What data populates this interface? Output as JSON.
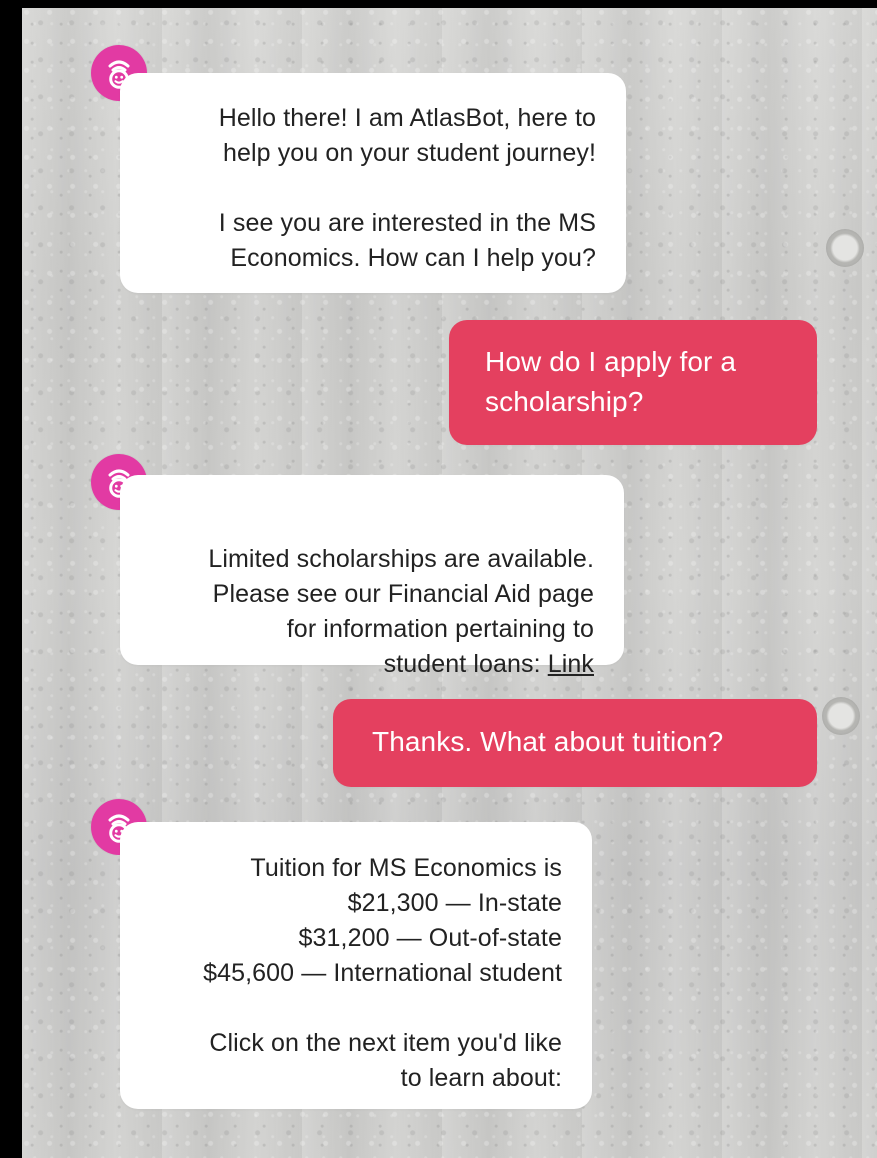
{
  "conversation": {
    "bot_name": "AtlasBot",
    "avatar_icon": "atlasbot-avatar-icon",
    "colors": {
      "bot_bubble": "#ffffff",
      "user_bubble": "#e4405f",
      "avatar": "#e23aa3"
    },
    "messages": [
      {
        "sender": "bot",
        "text": "Hello there! I am AtlasBot, here to\nhelp you on your student journey!\n\nI see you are interested in the MS\nEconomics. How can I help you?"
      },
      {
        "sender": "user",
        "text": "How do I apply for a\nscholarship?"
      },
      {
        "sender": "bot",
        "text_before_link": "Limited scholarships are available.\nPlease see our Financial Aid page\nfor information pertaining to\nstudent loans: ",
        "link_label": "Link"
      },
      {
        "sender": "user",
        "text": "Thanks. What about tuition?"
      },
      {
        "sender": "bot",
        "text": "Tuition for MS Economics is\n$21,300 — In-state\n$31,200 — Out-of-state\n$45,600 — International student\n\nClick on the next item you'd like\nto learn about:"
      }
    ]
  }
}
